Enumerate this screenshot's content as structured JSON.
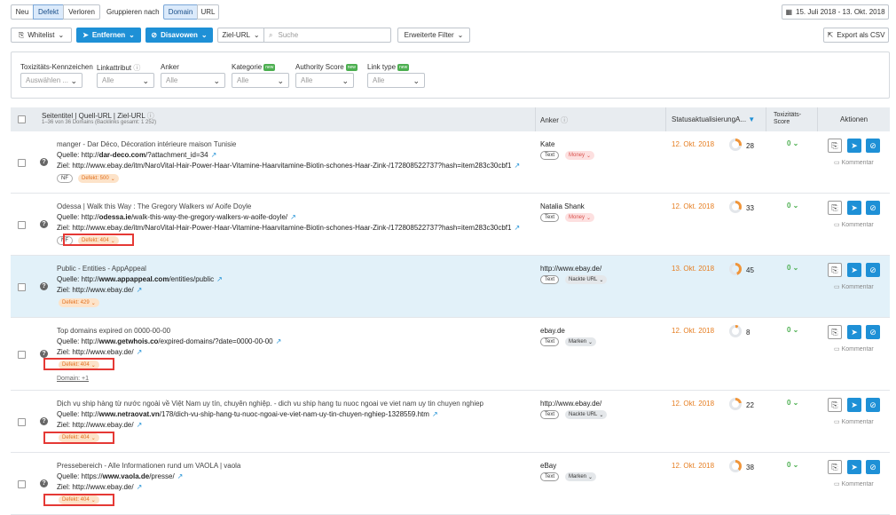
{
  "toolbar": {
    "seg": [
      "Neu",
      "Defekt",
      "Verloren"
    ],
    "group_label": "Gruppieren nach",
    "group": [
      "Domain",
      "URL"
    ],
    "date_range": "15. Juli 2018 - 13. Okt. 2018",
    "whitelist": "Whitelist",
    "entfernen": "Entfernen",
    "disavowen": "Disavowen",
    "ziel_url": "Ziel-URL",
    "search_placeholder": "Suche",
    "erweiterte": "Erweiterte Filter",
    "export": "Export als CSV"
  },
  "filters": [
    {
      "label": "Toxizitäts-Kennzeichen",
      "value": "Auswählen ..."
    },
    {
      "label": "Linkattribut",
      "value": "Alle"
    },
    {
      "label": "Anker",
      "value": "Alle"
    },
    {
      "label": "Kategorie",
      "value": "Alle",
      "badge": "new"
    },
    {
      "label": "Authority Score",
      "value": "Alle",
      "badge": "new"
    },
    {
      "label": "Link type",
      "value": "Alle",
      "badge": "new"
    }
  ],
  "header": {
    "col1": "Seitentitel | Quell-URL | Ziel-URL",
    "col1_sub": "1–36 von 36 Domains (Backlinks gesamt: 1 252)",
    "anker": "Anker",
    "status": "Statusaktualisierung",
    "as": "A...",
    "tox": "Toxizitäts-Score",
    "aktionen": "Aktionen"
  },
  "rows": [
    {
      "title": "manger - Dar Déco, Décoration intérieure maison Tunisie",
      "src_pre": "Quelle: http://",
      "src_b": "dar-deco.com",
      "src_post": "/?attachment_id=34",
      "tgt": "Ziel: http://www.ebay.de/itm/NaroVital-Hair-Power-Haar-Vitamine-Haarvitamine-Biotin-schones-Haar-Zink-/172808522737?hash=item283c30cbf1",
      "tag1": "NF",
      "tag2": "Defekt: 500",
      "anchor": "Kate",
      "chip2": "Money",
      "date": "12. Okt. 2018",
      "score": "28",
      "tox": "0",
      "komm": "Kommentar"
    },
    {
      "title": "Odessa | Walk this Way : The Gregory Walkers w/ Aoife Doyle",
      "src_pre": "Quelle: http://",
      "src_b": "odessa.ie",
      "src_post": "/walk-this-way-the-gregory-walkers-w-aoife-doyle/",
      "tgt": "Ziel: http://www.ebay.de/itm/NaroVital-Hair-Power-Haar-Vitamine-Haarvitamine-Biotin-schones-Haar-Zink-/172808522737?hash=item283c30cbf1",
      "tag1": "NF",
      "tag2": "Defekt: 404",
      "anchor": "Natalia Shank",
      "chip2": "Money",
      "date": "12. Okt. 2018",
      "score": "33",
      "tox": "0",
      "komm": "Kommentar"
    },
    {
      "title": "Public - Entities - AppAppeal",
      "src_pre": "Quelle: http://",
      "src_b": "www.appappeal.com",
      "src_post": "/entities/public",
      "tgt": "Ziel: http://www.ebay.de/",
      "tag2": "Defekt: 429",
      "anchor": "http://www.ebay.de/",
      "chip2": "Nackte URL",
      "date": "13. Okt. 2018",
      "score": "45",
      "tox": "0",
      "komm": "Kommentar"
    },
    {
      "title": "Top domains expired on 0000-00-00",
      "src_pre": "Quelle: http://",
      "src_b": "www.getwhois.co",
      "src_post": "/expired-domains/?date=0000-00-00",
      "tgt": "Ziel: http://www.ebay.de/",
      "tag2": "Defekt: 404",
      "domain_more": "Domain: +1",
      "anchor": "ebay.de",
      "chip2": "Marken",
      "date": "12. Okt. 2018",
      "score": "8",
      "tox": "0",
      "komm": "Kommentar"
    },
    {
      "title": "Dịch vụ ship hàng từ nước ngoài về Việt Nam uy tín, chuyên nghiệp. - dich vu ship hang tu nuoc ngoai ve viet nam uy tin chuyen nghiep",
      "src_pre": "Quelle: http://",
      "src_b": "www.netraovat.vn",
      "src_post": "/178/dich-vu-ship-hang-tu-nuoc-ngoai-ve-viet-nam-uy-tin-chuyen-nghiep-1328559.htm",
      "tgt": "Ziel: http://www.ebay.de/",
      "tag2": "Defekt: 404",
      "anchor": "http://www.ebay.de/",
      "chip2": "Nackte URL",
      "date": "12. Okt. 2018",
      "score": "22",
      "tox": "0",
      "komm": "Kommentar"
    },
    {
      "title": "Pressebereich - Alle Informationen rund um VAOLA | vaola",
      "src_pre": "Quelle: https://",
      "src_b": "www.vaola.de",
      "src_post": "/presse/",
      "tgt": "Ziel: http://www.ebay.de/",
      "tag2": "Defekt: 404",
      "anchor": "eBay",
      "chip2": "Marken",
      "date": "12. Okt. 2018",
      "score": "38",
      "tox": "0",
      "komm": "Kommentar"
    }
  ],
  "common": {
    "text_chip": "Text",
    "help": "?"
  },
  "colors": {
    "accent": "#1e90d6",
    "date": "#e67e22",
    "tox": "#4caf50",
    "defekt": "#e0701f",
    "redbox": "#e53935"
  }
}
